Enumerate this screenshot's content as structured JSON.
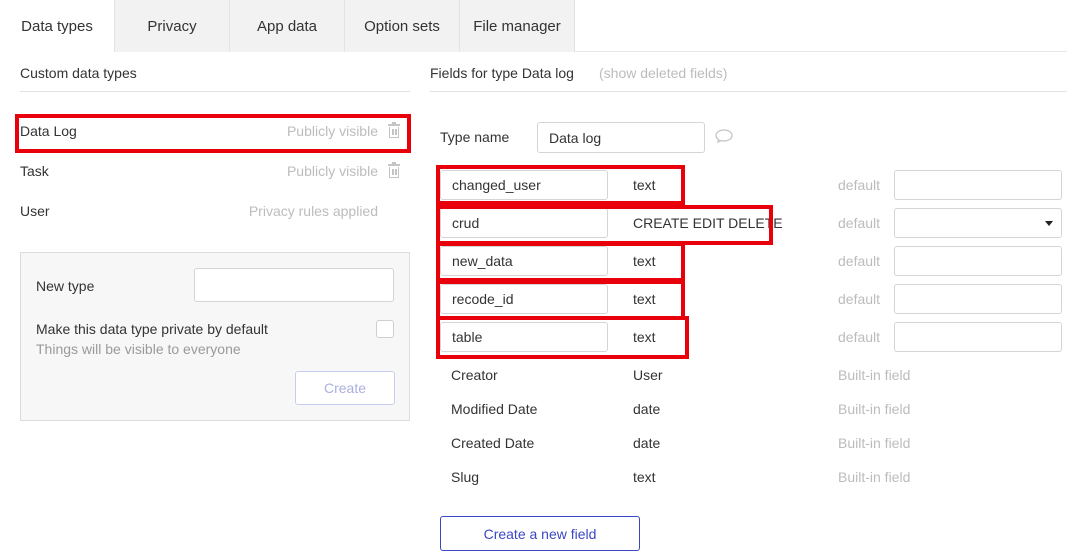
{
  "tabs": [
    {
      "label": "Data types",
      "active": true
    },
    {
      "label": "Privacy",
      "active": false
    },
    {
      "label": "App data",
      "active": false
    },
    {
      "label": "Option sets",
      "active": false
    },
    {
      "label": "File manager",
      "active": false
    }
  ],
  "left": {
    "heading": "Custom data types",
    "types": [
      {
        "name": "Data Log",
        "status": "Publicly visible",
        "trash": true
      },
      {
        "name": "Task",
        "status": "Publicly visible",
        "trash": true
      },
      {
        "name": "User",
        "status": "Privacy rules applied",
        "trash": false
      }
    ],
    "new_type": {
      "label": "New type",
      "value": "",
      "private_label": "Make this data type private by default",
      "private_hint": "Things will be visible to everyone",
      "private_checked": false,
      "create_label": "Create"
    }
  },
  "right": {
    "heading": "Fields for type Data log",
    "show_deleted": "(show deleted fields)",
    "type_name_label": "Type name",
    "type_name_value": "Data log",
    "custom_fields": [
      {
        "name": "changed_user",
        "type": "text",
        "default_label": "default",
        "default_value": "",
        "dropdown": false
      },
      {
        "name": "crud",
        "type": "CREATE EDIT DELETE",
        "default_label": "default",
        "default_value": "",
        "dropdown": true
      },
      {
        "name": "new_data",
        "type": "text",
        "default_label": "default",
        "default_value": "",
        "dropdown": false
      },
      {
        "name": "recode_id",
        "type": "text",
        "default_label": "default",
        "default_value": "",
        "dropdown": false
      },
      {
        "name": "table",
        "type": "text",
        "default_label": "default",
        "default_value": "",
        "dropdown": false
      }
    ],
    "builtin_fields": [
      {
        "name": "Creator",
        "type": "User",
        "label": "Built-in field"
      },
      {
        "name": "Modified Date",
        "type": "date",
        "label": "Built-in field"
      },
      {
        "name": "Created Date",
        "type": "date",
        "label": "Built-in field"
      },
      {
        "name": "Slug",
        "type": "text",
        "label": "Built-in field"
      }
    ],
    "create_field_label": "Create a new field"
  },
  "colors": {
    "highlight": "#e8000b",
    "accent": "#3c47c6",
    "muted": "#bcbcbc"
  }
}
